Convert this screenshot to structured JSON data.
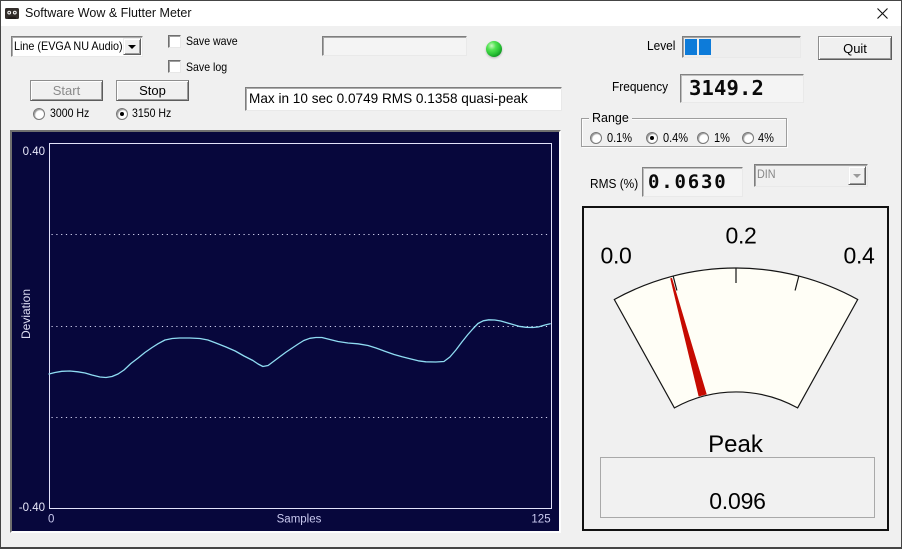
{
  "window": {
    "title": "Software Wow & Flutter Meter"
  },
  "device_select": {
    "value": "Line (EVGA NU Audio)"
  },
  "save_wave": {
    "label": "Save wave",
    "checked": false
  },
  "save_log": {
    "label": "Save log",
    "checked": false
  },
  "wave_file_input": {
    "value": ""
  },
  "led": {
    "state": "green"
  },
  "level": {
    "label": "Level",
    "segments_filled": 2,
    "segment_color": "#0d7bd9"
  },
  "quit_button": {
    "label": "Quit"
  },
  "start_button": {
    "label": "Start",
    "enabled": false
  },
  "stop_button": {
    "label": "Stop",
    "enabled": true
  },
  "test_frequency": {
    "options": [
      {
        "label": "3000 Hz",
        "selected": false
      },
      {
        "label": "3150 Hz",
        "selected": true
      }
    ]
  },
  "status": {
    "text": "Max in 10 sec 0.0749 RMS 0.1358 quasi-peak"
  },
  "frequency": {
    "label": "Frequency",
    "value": "3149.2"
  },
  "range": {
    "legend": "Range",
    "options": [
      {
        "label": "0.1%",
        "selected": false
      },
      {
        "label": "0.4%",
        "selected": true
      },
      {
        "label": "1%",
        "selected": false
      },
      {
        "label": "4%",
        "selected": false
      }
    ]
  },
  "rms": {
    "label": "RMS (%)",
    "value": "0.0630"
  },
  "weighting_select": {
    "value": "DIN",
    "enabled": false
  },
  "chart_data": {
    "type": "line",
    "xlabel": "Samples",
    "ylabel": "Deviation",
    "x_tick_left": "0",
    "x_tick_right": "125",
    "y_tick_top": "0.40",
    "y_tick_bottom": "-0.40",
    "xlim": [
      0,
      125
    ],
    "ylim": [
      -0.4,
      0.4
    ],
    "gridlines_y": [
      0.2,
      0.0,
      -0.2
    ],
    "bg_color": "#07073c",
    "line_color": "#8fdcf2",
    "axis_color": "#e2e2fa",
    "series": [
      {
        "name": "deviation",
        "x": [
          0.0,
          1.5,
          3.2,
          5.2,
          7.2,
          9.0,
          10.7,
          12.7,
          14.2,
          15.7,
          17.2,
          18.7,
          20.4,
          22.2,
          23.9,
          25.7,
          27.2,
          28.9,
          30.7,
          32.6,
          35.1,
          37.6,
          39.6,
          41.6,
          44.1,
          46.4,
          48.6,
          50.8,
          52.1,
          53.3,
          54.6,
          56.1,
          57.6,
          59.1,
          60.6,
          62.1,
          63.5,
          65.0,
          66.5,
          68.0,
          70.0,
          72.0,
          74.5,
          77.0,
          79.5,
          81.5,
          83.5,
          86.0,
          88.0,
          90.2,
          92.0,
          93.9,
          96.4,
          98.4,
          99.9,
          101.4,
          102.9,
          104.4,
          105.7,
          106.9,
          108.2,
          109.6,
          111.1,
          112.6,
          114.1,
          115.6,
          117.1,
          118.9,
          120.6,
          122.1,
          123.6,
          124.9
        ],
        "y": [
          -0.1063,
          -0.103,
          -0.1004,
          -0.0997,
          -0.1015,
          -0.1041,
          -0.1085,
          -0.1129,
          -0.114,
          -0.1118,
          -0.1063,
          -0.0975,
          -0.0833,
          -0.0712,
          -0.0592,
          -0.0482,
          -0.0399,
          -0.0318,
          -0.0285,
          -0.0274,
          -0.0274,
          -0.0285,
          -0.0318,
          -0.0384,
          -0.0471,
          -0.0559,
          -0.0668,
          -0.0767,
          -0.0844,
          -0.0899,
          -0.0877,
          -0.0778,
          -0.0679,
          -0.0581,
          -0.0493,
          -0.0405,
          -0.0329,
          -0.0281,
          -0.0263,
          -0.0263,
          -0.0307,
          -0.0351,
          -0.0384,
          -0.0401,
          -0.0438,
          -0.0493,
          -0.0559,
          -0.0636,
          -0.0686,
          -0.0734,
          -0.0774,
          -0.0796,
          -0.08,
          -0.0789,
          -0.069,
          -0.0537,
          -0.0362,
          -0.0197,
          -0.0066,
          0.0044,
          0.0103,
          0.0125,
          0.0121,
          0.0099,
          0.0059,
          0.0022,
          -0.0018,
          -0.0039,
          -0.0044,
          -0.0028,
          0.0011,
          0.0037
        ]
      }
    ]
  },
  "gauge": {
    "min": 0.0,
    "max": 0.4,
    "scale_labels": [
      "0.0",
      "0.2",
      "0.4"
    ],
    "ticks": [
      0.1,
      0.2,
      0.3
    ],
    "needle_value": 0.096,
    "needle_color": "#c60b01",
    "label": "Peak",
    "value": "0.096"
  }
}
